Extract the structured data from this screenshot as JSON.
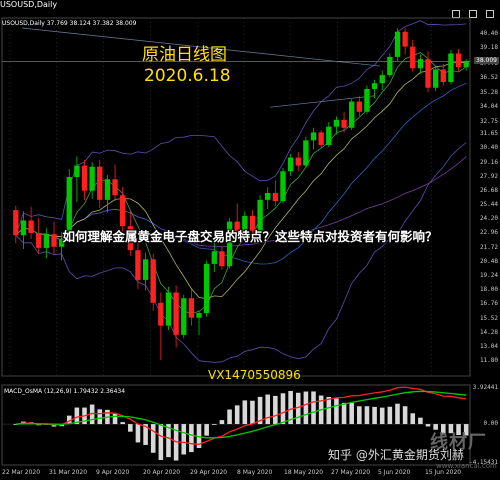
{
  "window": {
    "title": "USOUSD,Daily",
    "symbol_info": "USOUSD,Daily 37.769 38.124 37.382 38.009",
    "buttons": [
      "minimize-icon",
      "restore-icon",
      "close-icon"
    ]
  },
  "overlay": {
    "title_cn": "原油日线图",
    "date": "2020.6.18",
    "banner": "如何理解金属黄金电子盘交易的特点？这些特点对投资者有何影响？",
    "watermark_code": "VX1470550896",
    "watermark_site": "线材厂",
    "watermark_account": "知乎 @外汇黄金期货刘赫",
    "watermark_url": "www.xiancai.com"
  },
  "colors": {
    "bull": "#00c800",
    "bear": "#ff2020",
    "grid": "#3a3a3a",
    "text": "#cccccc",
    "accent": "#ffe000",
    "macd_line": "#ff2020",
    "signal_line": "#00c800"
  },
  "macd": {
    "label": "MACD_OsMA (12,26,9) 1.79432 2.36434",
    "y_labels": [
      "3.92441",
      "0.00",
      "-4.15431"
    ]
  },
  "chart_data": {
    "type": "candlestick",
    "title": "",
    "y_labels": [
      "40.40",
      "39.18",
      "37.76",
      "36.52",
      "35.28",
      "34.04",
      "32.75",
      "31.65",
      "30.40",
      "29.16",
      "27.92",
      "26.68",
      "25.44",
      "24.20",
      "22.96",
      "21.72",
      "20.48",
      "19.24",
      "18.00",
      "16.76",
      "15.52",
      "14.28",
      "13.04",
      "11.80"
    ],
    "current_price": "38.009",
    "x_labels": [
      "22 Mar 2020",
      "31 Mar 2020",
      "9 Apr 2020",
      "20 Apr 2020",
      "29 Apr 2020",
      "8 May 2020",
      "18 May 2020",
      "27 May 2020",
      "5 Jun 2020",
      "15 Jun 2020"
    ],
    "ylim": [
      10.5,
      41.8
    ],
    "candles": [
      [
        25.0,
        25.4,
        22.1,
        22.8
      ],
      [
        22.8,
        24.9,
        21.6,
        24.1
      ],
      [
        24.1,
        25.3,
        22.5,
        23.0
      ],
      [
        23.0,
        24.3,
        21.2,
        21.7
      ],
      [
        21.7,
        23.4,
        20.8,
        22.9
      ],
      [
        22.9,
        24.0,
        21.1,
        21.8
      ],
      [
        21.8,
        23.1,
        20.6,
        22.5
      ],
      [
        22.5,
        28.6,
        22.2,
        27.9
      ],
      [
        27.9,
        29.7,
        25.7,
        28.9
      ],
      [
        28.9,
        29.4,
        25.9,
        26.7
      ],
      [
        26.7,
        29.2,
        26.0,
        28.8
      ],
      [
        28.8,
        29.4,
        25.2,
        25.9
      ],
      [
        25.9,
        28.1,
        24.8,
        27.7
      ],
      [
        27.7,
        29.0,
        25.8,
        26.3
      ],
      [
        26.3,
        27.0,
        23.0,
        23.6
      ],
      [
        23.6,
        24.9,
        21.0,
        21.5
      ],
      [
        21.5,
        22.4,
        18.1,
        18.9
      ],
      [
        18.9,
        21.3,
        18.0,
        20.7
      ],
      [
        20.7,
        21.2,
        16.2,
        16.9
      ],
      [
        16.9,
        17.8,
        11.9,
        14.9
      ],
      [
        14.9,
        18.3,
        14.5,
        17.8
      ],
      [
        17.8,
        18.4,
        13.0,
        14.1
      ],
      [
        14.1,
        17.6,
        13.8,
        17.3
      ],
      [
        17.3,
        18.1,
        14.9,
        15.6
      ],
      [
        15.6,
        16.2,
        14.1,
        16.0
      ],
      [
        16.0,
        20.6,
        15.7,
        20.3
      ],
      [
        20.3,
        22.3,
        19.6,
        21.4
      ],
      [
        21.4,
        21.9,
        19.8,
        20.1
      ],
      [
        20.1,
        24.3,
        19.9,
        24.0
      ],
      [
        24.0,
        25.6,
        22.3,
        22.9
      ],
      [
        22.9,
        24.9,
        22.6,
        24.5
      ],
      [
        24.5,
        25.0,
        22.1,
        23.2
      ],
      [
        23.2,
        26.3,
        23.0,
        25.9
      ],
      [
        25.9,
        27.0,
        25.1,
        26.5
      ],
      [
        26.5,
        27.6,
        25.4,
        25.8
      ],
      [
        25.8,
        28.7,
        25.6,
        28.4
      ],
      [
        28.4,
        29.9,
        28.0,
        29.6
      ],
      [
        29.6,
        30.1,
        28.4,
        28.9
      ],
      [
        28.9,
        31.4,
        28.7,
        31.1
      ],
      [
        31.1,
        32.2,
        30.3,
        31.8
      ],
      [
        31.8,
        32.0,
        30.4,
        30.7
      ],
      [
        30.7,
        32.7,
        30.5,
        32.3
      ],
      [
        32.3,
        33.2,
        31.6,
        32.9
      ],
      [
        32.9,
        33.6,
        31.8,
        32.2
      ],
      [
        32.2,
        34.7,
        32.0,
        34.5
      ],
      [
        34.5,
        35.0,
        33.2,
        33.6
      ],
      [
        33.6,
        35.9,
        33.4,
        35.6
      ],
      [
        35.6,
        36.4,
        34.8,
        36.1
      ],
      [
        36.1,
        37.2,
        35.5,
        36.8
      ],
      [
        36.8,
        38.7,
        36.6,
        38.4
      ],
      [
        38.4,
        40.9,
        38.0,
        40.6
      ],
      [
        40.6,
        40.9,
        38.6,
        39.3
      ],
      [
        39.3,
        39.9,
        37.1,
        37.4
      ],
      [
        37.4,
        38.6,
        36.9,
        38.2
      ],
      [
        38.2,
        38.9,
        35.3,
        35.7
      ],
      [
        35.7,
        37.6,
        35.4,
        37.3
      ],
      [
        37.3,
        37.8,
        35.9,
        36.2
      ],
      [
        36.2,
        39.0,
        36.0,
        38.7
      ],
      [
        38.7,
        39.1,
        37.1,
        37.5
      ],
      [
        37.5,
        38.2,
        37.2,
        38.0
      ]
    ]
  }
}
